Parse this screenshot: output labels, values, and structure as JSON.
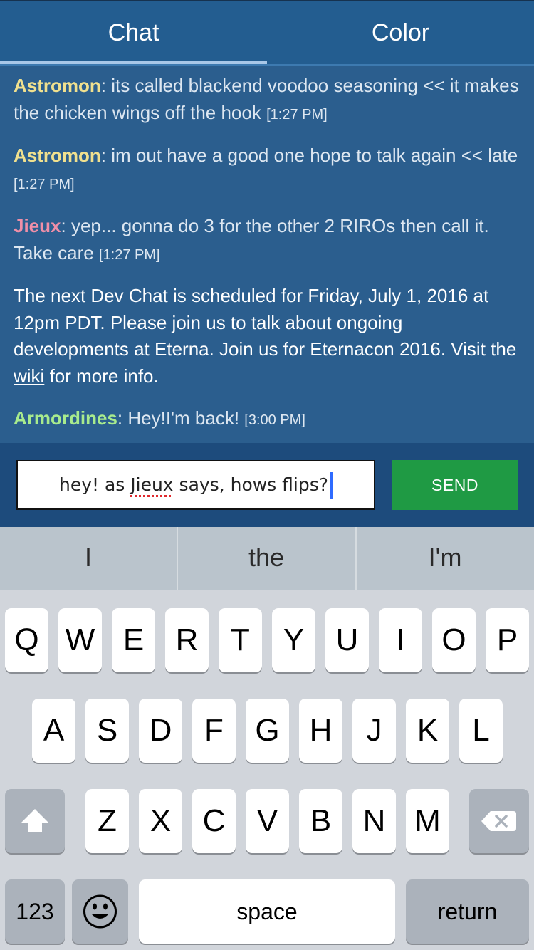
{
  "tabs": {
    "chat": "Chat",
    "color": "Color"
  },
  "messages": [
    {
      "user": "Astromon",
      "sep": ": ",
      "text": "its called blackend voodoo seasoning << it makes the chicken wings off the hook",
      "time": "[1:27 PM]"
    },
    {
      "user": "Astromon",
      "sep": ": ",
      "text": "im out have a good one hope to talk again << late",
      "time": "[1:27 PM]"
    },
    {
      "user": "Jieux",
      "sep": ": ",
      "text": "yep... gonna do 3 for the other 2 RIROs then call it. Take care",
      "time": "[1:27 PM]"
    },
    {
      "user": "Armordines",
      "sep": ": ",
      "text": "Hey!I'm back!",
      "time": "[3:00 PM]"
    }
  ],
  "announcement": {
    "before": "The next Dev Chat is scheduled for Friday, July 1, 2016 at 12pm PDT. Please join us to talk about ongoing developments at Eterna. Join us for Eternacon 2016. Visit the ",
    "link": "wiki",
    "after": " for more info."
  },
  "input": {
    "part1": "hey! as ",
    "misspelled": "Jieux",
    "part2": " says, hows flips?"
  },
  "send_label": "SEND",
  "suggestions": [
    "I",
    "the",
    "I'm"
  ],
  "keyboard": {
    "row1": [
      "Q",
      "W",
      "E",
      "R",
      "T",
      "Y",
      "U",
      "I",
      "O",
      "P"
    ],
    "row2": [
      "A",
      "S",
      "D",
      "F",
      "G",
      "H",
      "J",
      "K",
      "L"
    ],
    "row3": [
      "Z",
      "X",
      "C",
      "V",
      "B",
      "N",
      "M"
    ],
    "numbers": "123",
    "space": "space",
    "return": "return",
    "shift_icon": "shift-icon",
    "delete_icon": "backspace-icon",
    "emoji_icon": "emoji-icon"
  },
  "colors": {
    "astromon": "#f0e08e",
    "jieux": "#f08fa8",
    "armordines": "#a8eb8d",
    "send": "#1f9a44",
    "header": "#235d90"
  }
}
